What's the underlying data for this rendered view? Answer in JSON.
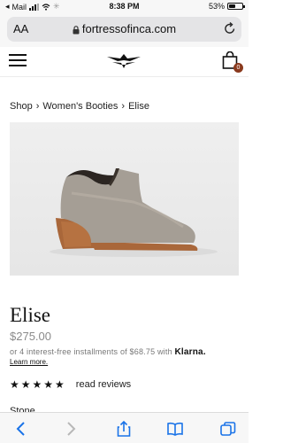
{
  "status_bar": {
    "carrier": "Mail",
    "time": "8:38 PM",
    "battery": "53%",
    "battery_level": 0.53
  },
  "browser": {
    "text_size_label": "AA",
    "url": "fortressofinca.com",
    "icons": [
      "lock-icon",
      "reload-icon"
    ]
  },
  "header": {
    "icons": [
      "hamburger-menu-icon",
      "brand-logo",
      "shopping-bag-icon"
    ],
    "cart_count": "0"
  },
  "breadcrumb": {
    "items": [
      "Shop",
      "Women's Booties",
      "Elise"
    ],
    "separator": "›"
  },
  "product": {
    "image_alt": "grey suede ankle bootie",
    "title": "Elise",
    "price": "$275.00",
    "installments_text": "or 4 interest-free installments of $68.75 with",
    "installments_brand": "Klarna.",
    "learn_more": "Learn more.",
    "stars": "★★★★★",
    "rating_value": 5,
    "read_reviews": "read reviews",
    "color_label": "Stone"
  },
  "toolbar": {
    "icons": [
      "back-icon",
      "forward-icon",
      "share-icon",
      "bookmarks-icon",
      "tabs-icon"
    ]
  },
  "colors": {
    "accent_badge": "#8a3a1e",
    "text": "#222222",
    "muted": "#8a8a8a",
    "chrome_bg": "#f7f7f7"
  }
}
